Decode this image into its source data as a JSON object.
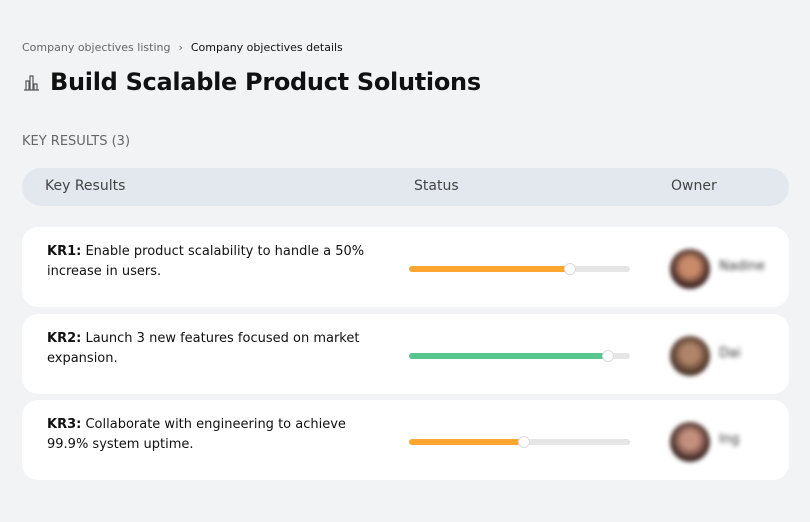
{
  "breadcrumb": {
    "parent": "Company objectives listing",
    "current": "Company objectives details"
  },
  "page_title": "Build Scalable Product Solutions",
  "key_results_count_label": "KEY RESULTS (3)",
  "table_header": {
    "key_results": "Key Results",
    "status": "Status",
    "owner": "Owner"
  },
  "colors": {
    "orange": "#ffa630",
    "green": "#56c68f"
  },
  "key_results": [
    {
      "id": "KR1:",
      "text": "Enable product scalability to handle a 50% increase in users.",
      "progress": 73,
      "color": "#ffa630",
      "owner": "Nadine"
    },
    {
      "id": "KR2:",
      "text": "Launch 3 new features focused on market expansion.",
      "progress": 90,
      "color": "#56c68f",
      "owner": "Dai"
    },
    {
      "id": "KR3:",
      "text": "Collaborate with engineering to achieve 99.9% system uptime.",
      "progress": 52,
      "color": "#ffa630",
      "owner": "Ing"
    }
  ]
}
